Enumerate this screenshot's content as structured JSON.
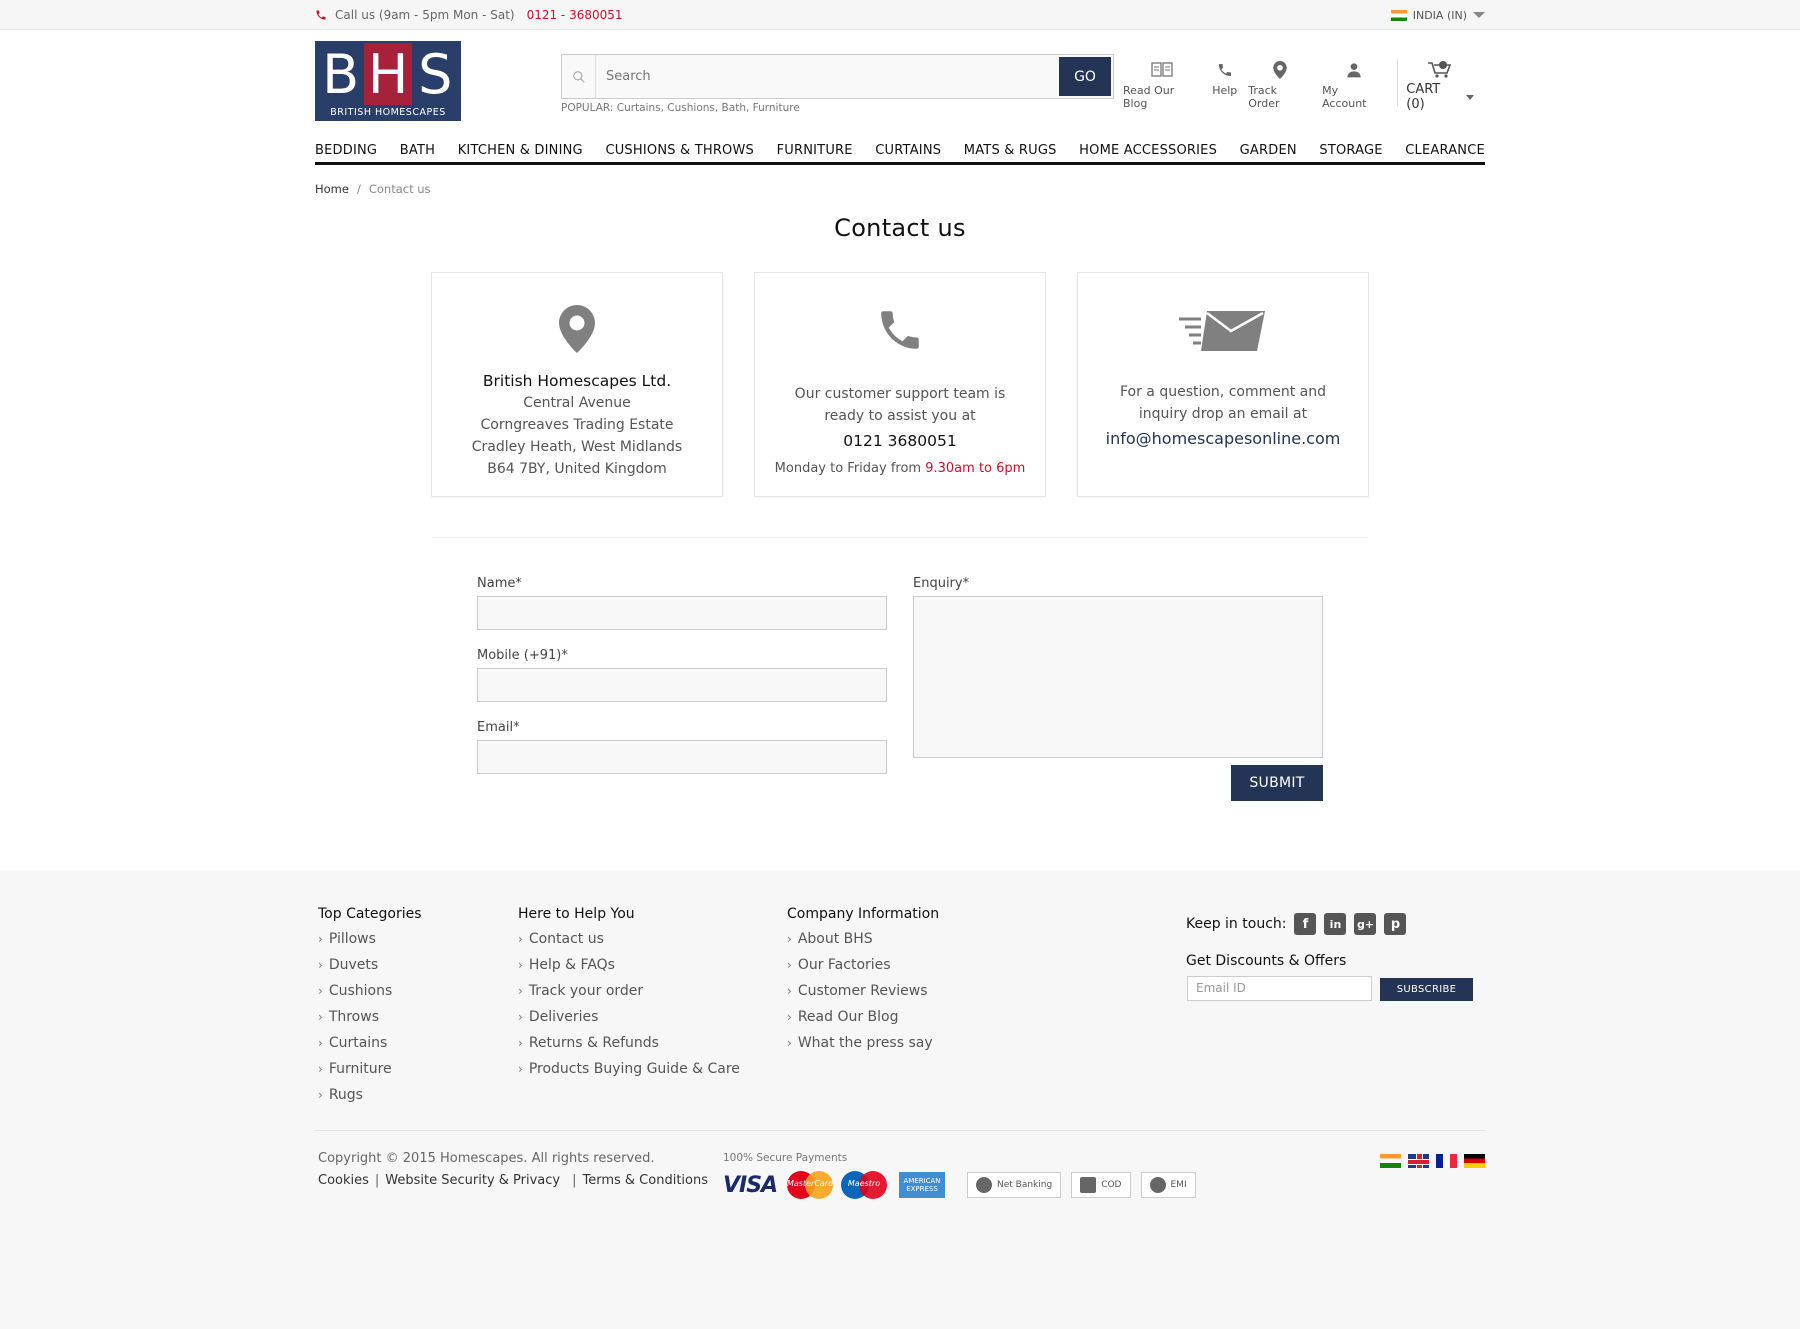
{
  "topbar": {
    "call_text": "Call us (9am - 5pm Mon - Sat)",
    "phone": "0121 - 3680051",
    "locale": "INDIA (IN)"
  },
  "logo": {
    "letters": [
      "B",
      "H",
      "S"
    ],
    "subtitle": "BRITISH HOMESCAPES"
  },
  "search": {
    "placeholder": "Search",
    "go_label": "GO",
    "popular": "POPULAR: Curtains, Cushions, Bath,  Furniture"
  },
  "header_links": {
    "blog": "Read Our Blog",
    "help": "Help",
    "track": "Track Order",
    "account": "My Account",
    "cart": "CART (0)"
  },
  "nav": [
    "BEDDING",
    "BATH",
    "KITCHEN & DINING",
    "CUSHIONS & THROWS",
    "FURNITURE",
    "CURTAINS",
    "MATS & RUGS",
    "HOME ACCESSORIES",
    "GARDEN",
    "STORAGE",
    "CLEARANCE"
  ],
  "breadcrumb": {
    "home": "Home",
    "sep": "/",
    "current": "Contact us"
  },
  "page_title": "Contact us",
  "cards": {
    "address": {
      "company": "British Homescapes Ltd.",
      "line1": "Central Avenue",
      "line2": "Corngreaves Trading Estate",
      "line3": "Cradley Heath, West Midlands",
      "line4": "B64 7BY, United Kingdom"
    },
    "phone": {
      "line1": "Our customer support team is",
      "line2": "ready to assist you at",
      "number": "0121 3680051",
      "hours_prefix": "Monday to Friday from",
      "hours": "9.30am to 6pm"
    },
    "email": {
      "line1": "For a question, comment and",
      "line2": "inquiry drop an email at",
      "address": "info@homescapesonline.com"
    }
  },
  "form": {
    "name_label": "Name*",
    "mobile_label": "Mobile (+91)*",
    "email_label": "Email*",
    "enquiry_label": "Enquiry*",
    "submit_label": "SUBMIT"
  },
  "footer": {
    "top_categories": {
      "title": "Top Categories",
      "items": [
        "Pillows",
        "Duvets",
        "Cushions",
        "Throws",
        "Curtains",
        "Furniture",
        "Rugs"
      ]
    },
    "help": {
      "title": "Here to Help You",
      "items": [
        "Contact us",
        "Help & FAQs",
        "Track your order",
        "Deliveries",
        "Returns & Refunds",
        "Products Buying Guide & Care"
      ]
    },
    "company": {
      "title": "Company Information",
      "items": [
        "About BHS",
        "Our Factories",
        "Customer Reviews",
        "Read Our Blog",
        "What the press say"
      ]
    },
    "keep_in_touch": "Keep in touch:",
    "social": [
      "f",
      "in",
      "g+",
      "p"
    ],
    "discounts_title": "Get Discounts & Offers",
    "email_placeholder": "Email ID",
    "subscribe_label": "SUBSCRIBE",
    "copyright": "Copyright © 2015 Homescapes. All rights reserved.",
    "links": [
      "Cookies",
      "Website Security & Privacy",
      "Terms & Conditions"
    ],
    "secure_payments": "100% Secure Payments",
    "payments": {
      "visa": "VISA",
      "mastercard": "MasterCard",
      "maestro": "Maestro",
      "amex": "AMERICAN EXPRESS",
      "netbanking": "Net Banking",
      "cod": "COD",
      "emi": "EMI"
    }
  },
  "colors": {
    "navy": "#233456",
    "red": "#c8102e",
    "logo_red": "#a8213a"
  }
}
